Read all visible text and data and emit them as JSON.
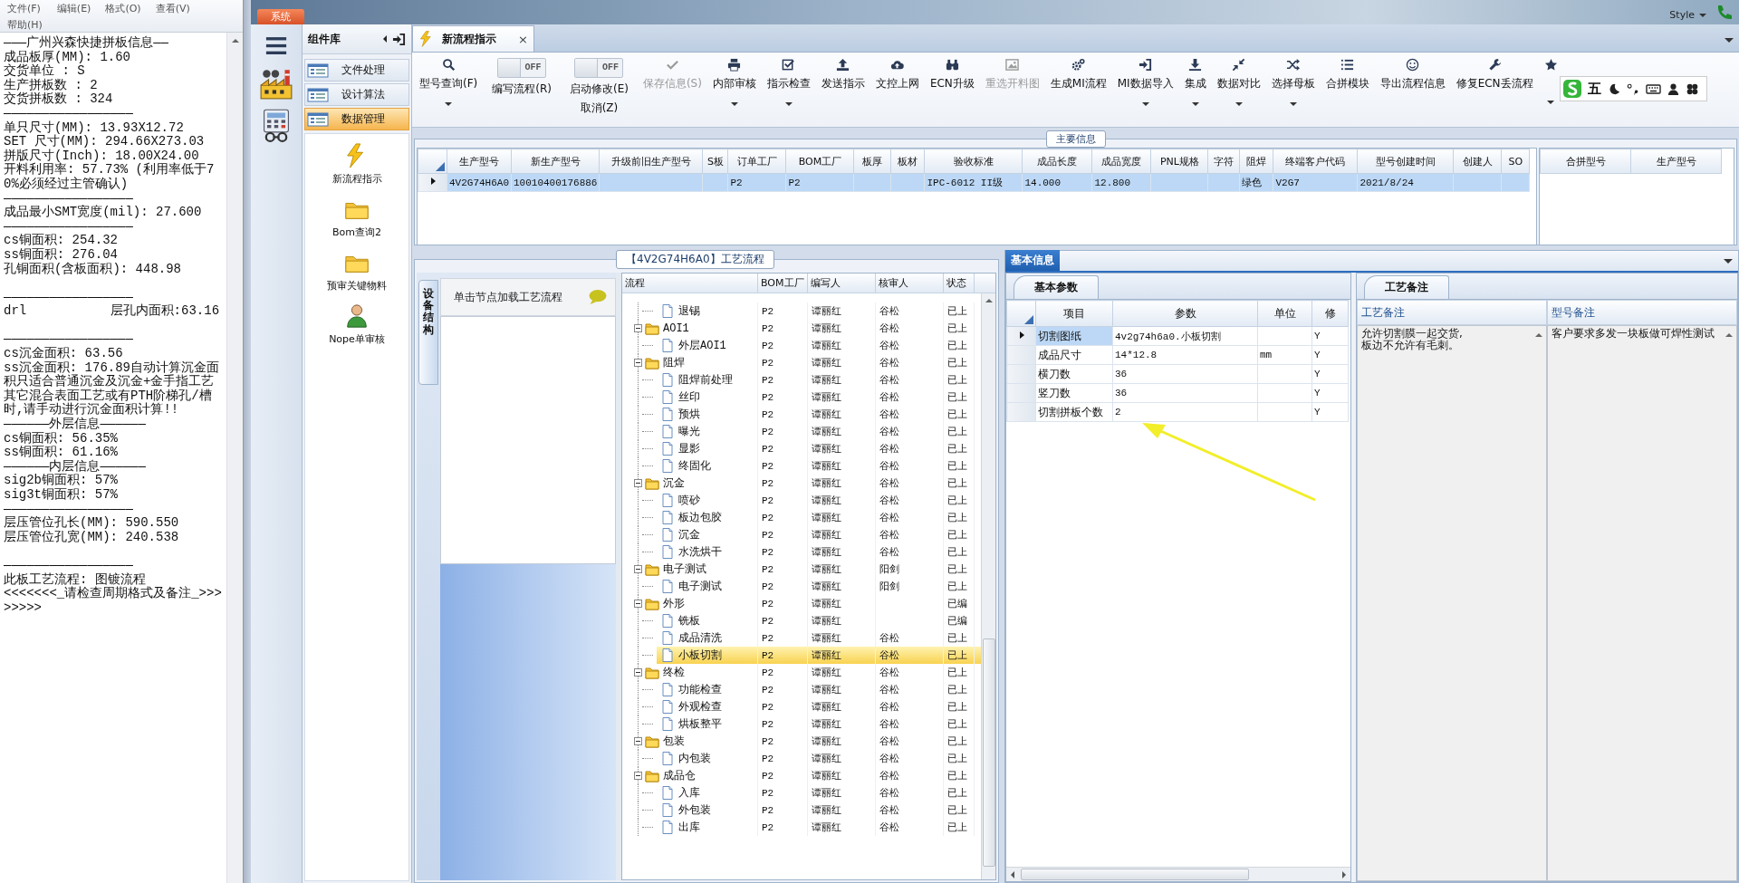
{
  "notepad": {
    "menu": [
      "文件(F)",
      "编辑(E)",
      "格式(O)",
      "查看(V)",
      "帮助(H)"
    ],
    "lines": [
      {
        "text": "———广州兴森快捷拼板信息——"
      },
      {
        "text": "成品板厚(MM): 1.60"
      },
      {
        "text": "交货单位 : S"
      },
      {
        "text": "生产拼板数 : 2"
      },
      {
        "text": "交货拼板数 : 324"
      },
      {
        "text": "—————————————————"
      },
      {
        "text": "单只尺寸(MM): 13.93X12.72"
      },
      {
        "text": "SET 尺寸(MM): 294.66X273.03"
      },
      {
        "text": "拼版尺寸(Inch): 18.00X24.00"
      },
      {
        "text": "开料利用率: 57.73% (利用率低于70%必须经过主管确认)"
      },
      {
        "text": "—————————————————"
      },
      {
        "text": "成品最小SMT宽度(mil): 27.600"
      },
      {
        "text": "—————————————————"
      },
      {
        "text": "cs铜面积: 254.32"
      },
      {
        "text": "ss铜面积: 276.04"
      },
      {
        "text": "孔铜面积(含板面积): 448.98"
      },
      {
        "text": "—————————————————",
        "gap_before": true
      },
      {
        "text": "drl           层孔内面积:63.16"
      },
      {
        "text": "—————————————————",
        "gap_before": true
      },
      {
        "text": "cs沉金面积: 63.56"
      },
      {
        "text": "ss沉金面积: 176.89自动计算沉金面积只适合普通沉金及沉金+金手指工艺"
      },
      {
        "text": "其它混合表面工艺或有PTH阶梯孔/槽时,请手动进行沉金面积计算!!"
      },
      {
        "text": "——————外层信息——————"
      },
      {
        "text": "cs铜面积: 56.35%"
      },
      {
        "text": "ss铜面积: 61.16%"
      },
      {
        "text": "——————内层信息——————"
      },
      {
        "text": "sig2b铜面积: 57%"
      },
      {
        "text": "sig3t铜面积: 57%"
      },
      {
        "text": "—————————————————"
      },
      {
        "text": "层压管位孔长(MM): 590.550"
      },
      {
        "text": "层压管位孔宽(MM): 240.538"
      },
      {
        "text": "—————————————————",
        "gap_before": true
      },
      {
        "text": "此板工艺流程: 图镀流程"
      },
      {
        "text": "<<<<<<<_请检查周期格式及备注_>>>>>>>>"
      }
    ]
  },
  "app": {
    "system_tab": "系统",
    "style_label": "Style"
  },
  "sidebar": {
    "title": "组件库",
    "items": [
      {
        "label": "文件处理",
        "selected": false
      },
      {
        "label": "设计算法",
        "selected": false
      },
      {
        "label": "数据管理",
        "selected": true
      }
    ],
    "launchers": [
      {
        "label": "新流程指示"
      },
      {
        "label": "Bom查询2"
      },
      {
        "label": "预审关键物料"
      },
      {
        "label": "Nope单审核"
      }
    ]
  },
  "document_tab": {
    "label": "新流程指示",
    "close": "×"
  },
  "toolbar": {
    "items": [
      {
        "kind": "button",
        "label": "型号查询(F)",
        "dropdown": true,
        "disabled": false
      },
      {
        "kind": "toggle",
        "switch": "OFF",
        "on": false,
        "label": "编写流程(R)"
      },
      {
        "kind": "toggle",
        "switch": "OFF",
        "on": false,
        "label": "启动修改(E)",
        "label2": "取消(Z)"
      },
      {
        "kind": "button",
        "label": "保存信息(S)",
        "dropdown": false,
        "disabled": true
      },
      {
        "kind": "button",
        "label": "内部审核",
        "dropdown": true,
        "disabled": false
      },
      {
        "kind": "button",
        "label": "指示检查",
        "dropdown": true,
        "disabled": false
      },
      {
        "kind": "button",
        "label": "发送指示",
        "dropdown": false,
        "disabled": false
      },
      {
        "kind": "button",
        "label": "文控上网",
        "dropdown": false,
        "disabled": false
      },
      {
        "kind": "button",
        "label": "ECN升级",
        "dropdown": false,
        "disabled": false
      },
      {
        "kind": "button",
        "label": "重选开料图",
        "dropdown": false,
        "disabled": true
      },
      {
        "kind": "button",
        "label": "生成MI流程",
        "dropdown": false,
        "disabled": false
      },
      {
        "kind": "button",
        "label": "MI数据导入",
        "dropdown": true,
        "disabled": false
      },
      {
        "kind": "button",
        "label": "集成",
        "dropdown": true,
        "disabled": false
      },
      {
        "kind": "button",
        "label": "数据对比",
        "dropdown": true,
        "disabled": false
      },
      {
        "kind": "button",
        "label": "选择母板",
        "dropdown": true,
        "disabled": false
      },
      {
        "kind": "button",
        "label": "合拼模块",
        "dropdown": false,
        "disabled": false
      },
      {
        "kind": "button",
        "label": "导出流程信息",
        "dropdown": false,
        "disabled": false
      },
      {
        "kind": "button",
        "label": "修复ECN丢流程",
        "dropdown": false,
        "disabled": false
      },
      {
        "kind": "button",
        "dropdown": true,
        "disabled": false
      }
    ]
  },
  "ime": {
    "mode": "五"
  },
  "main_info": {
    "title": "主要信息",
    "columns": [
      "生产型号",
      "新生产型号",
      "升级前旧生产型号",
      "S板",
      "订单工厂",
      "BOM工厂",
      "板厚",
      "板材",
      "验收标准",
      "成品长度",
      "成品宽度",
      "PNL规格",
      "字符",
      "阻焊",
      "终端客户代码",
      "型号创建时间",
      "创建人",
      "SO"
    ],
    "rows": [
      {
        "selected": true,
        "cells": [
          "4V2G74H6A0",
          "10010400176886",
          null,
          null,
          "P2",
          "P2",
          null,
          null,
          "IPC-6012 II级",
          "14.000",
          "12.800",
          null,
          null,
          "绿色",
          "V2G7",
          "2021/8/24",
          null,
          null
        ]
      }
    ],
    "side_columns": [
      "合拼型号",
      "生产型号"
    ]
  },
  "process": {
    "title": "【4V2G74H6A0】工艺流程",
    "side_tab": "设备结构",
    "hint": "单击节点加载工艺流程",
    "columns": [
      "流程",
      "BOM工厂",
      "编写人",
      "核审人",
      "状态"
    ],
    "rows": [
      {
        "kind": "file",
        "name": "退锡",
        "bom": "P2",
        "writer": "谭丽红",
        "reviewer": "谷松",
        "status": "已上",
        "selected": false
      },
      {
        "kind": "folder",
        "name": "AOI1",
        "bom": "P2",
        "writer": "谭丽红",
        "reviewer": "谷松",
        "status": "已上",
        "selected": false,
        "expanded": true,
        "children": [
          {
            "kind": "file",
            "name": "外层AOI1",
            "bom": "P2",
            "writer": "谭丽红",
            "reviewer": "谷松",
            "status": "已上",
            "selected": false
          }
        ]
      },
      {
        "kind": "folder",
        "name": "阻焊",
        "bom": "P2",
        "writer": "谭丽红",
        "reviewer": "谷松",
        "status": "已上",
        "selected": false,
        "expanded": true,
        "children": [
          {
            "kind": "file",
            "name": "阻焊前处理",
            "bom": "P2",
            "writer": "谭丽红",
            "reviewer": "谷松",
            "status": "已上",
            "selected": false
          },
          {
            "kind": "file",
            "name": "丝印",
            "bom": "P2",
            "writer": "谭丽红",
            "reviewer": "谷松",
            "status": "已上",
            "selected": false
          },
          {
            "kind": "file",
            "name": "预烘",
            "bom": "P2",
            "writer": "谭丽红",
            "reviewer": "谷松",
            "status": "已上",
            "selected": false
          },
          {
            "kind": "file",
            "name": "曝光",
            "bom": "P2",
            "writer": "谭丽红",
            "reviewer": "谷松",
            "status": "已上",
            "selected": false
          },
          {
            "kind": "file",
            "name": "显影",
            "bom": "P2",
            "writer": "谭丽红",
            "reviewer": "谷松",
            "status": "已上",
            "selected": false
          },
          {
            "kind": "file",
            "name": "终固化",
            "bom": "P2",
            "writer": "谭丽红",
            "reviewer": "谷松",
            "status": "已上",
            "selected": false
          }
        ]
      },
      {
        "kind": "folder",
        "name": "沉金",
        "bom": "P2",
        "writer": "谭丽红",
        "reviewer": "谷松",
        "status": "已上",
        "selected": false,
        "expanded": true,
        "children": [
          {
            "kind": "file",
            "name": "喷砂",
            "bom": "P2",
            "writer": "谭丽红",
            "reviewer": "谷松",
            "status": "已上",
            "selected": false
          },
          {
            "kind": "file",
            "name": "板边包胶",
            "bom": "P2",
            "writer": "谭丽红",
            "reviewer": "谷松",
            "status": "已上",
            "selected": false
          },
          {
            "kind": "file",
            "name": "沉金",
            "bom": "P2",
            "writer": "谭丽红",
            "reviewer": "谷松",
            "status": "已上",
            "selected": false
          },
          {
            "kind": "file",
            "name": "水洗烘干",
            "bom": "P2",
            "writer": "谭丽红",
            "reviewer": "谷松",
            "status": "已上",
            "selected": false
          }
        ]
      },
      {
        "kind": "folder",
        "name": "电子测试",
        "bom": "P2",
        "writer": "谭丽红",
        "reviewer": "阳剑",
        "status": "已上",
        "selected": false,
        "expanded": true,
        "children": [
          {
            "kind": "file",
            "name": "电子测试",
            "bom": "P2",
            "writer": "谭丽红",
            "reviewer": "阳剑",
            "status": "已上",
            "selected": false
          }
        ]
      },
      {
        "kind": "folder",
        "name": "外形",
        "bom": "P2",
        "writer": "谭丽红",
        "status": "已编",
        "selected": false,
        "expanded": true,
        "children": [
          {
            "kind": "file",
            "name": "铣板",
            "bom": "P2",
            "writer": "谭丽红",
            "status": "已编",
            "selected": false
          },
          {
            "kind": "file",
            "name": "成品清洗",
            "bom": "P2",
            "writer": "谭丽红",
            "reviewer": "谷松",
            "status": "已上",
            "selected": false
          },
          {
            "kind": "file",
            "name": "小板切割",
            "bom": "P2",
            "writer": "谭丽红",
            "reviewer": "谷松",
            "status": "已上",
            "selected": true
          }
        ]
      },
      {
        "kind": "folder",
        "name": "终检",
        "bom": "P2",
        "writer": "谭丽红",
        "reviewer": "谷松",
        "status": "已上",
        "selected": false,
        "expanded": true,
        "children": [
          {
            "kind": "file",
            "name": "功能检查",
            "bom": "P2",
            "writer": "谭丽红",
            "reviewer": "谷松",
            "status": "已上",
            "selected": false
          },
          {
            "kind": "file",
            "name": "外观检查",
            "bom": "P2",
            "writer": "谭丽红",
            "reviewer": "谷松",
            "status": "已上",
            "selected": false
          },
          {
            "kind": "file",
            "name": "烘板整平",
            "bom": "P2",
            "writer": "谭丽红",
            "reviewer": "谷松",
            "status": "已上",
            "selected": false
          }
        ]
      },
      {
        "kind": "folder",
        "name": "包装",
        "bom": "P2",
        "writer": "谭丽红",
        "reviewer": "谷松",
        "status": "已上",
        "selected": false,
        "expanded": true,
        "children": [
          {
            "kind": "file",
            "name": "内包装",
            "bom": "P2",
            "writer": "谭丽红",
            "reviewer": "谷松",
            "status": "已上",
            "selected": false
          }
        ]
      },
      {
        "kind": "folder",
        "name": "成品仓",
        "bom": "P2",
        "writer": "谭丽红",
        "reviewer": "谷松",
        "status": "已上",
        "selected": false,
        "expanded": true,
        "children": [
          {
            "kind": "file",
            "name": "入库",
            "bom": "P2",
            "writer": "谭丽红",
            "reviewer": "谷松",
            "status": "已上",
            "selected": false
          },
          {
            "kind": "file",
            "name": "外包装",
            "bom": "P2",
            "writer": "谭丽红",
            "reviewer": "谷松",
            "status": "已上",
            "selected": false
          },
          {
            "kind": "file",
            "name": "出库",
            "bom": "P2",
            "writer": "谭丽红",
            "reviewer": "谷松",
            "status": "已上",
            "selected": false
          }
        ]
      }
    ]
  },
  "info": {
    "tab": "基本信息",
    "params": {
      "tab": "基本参数",
      "columns": [
        "项目",
        "参数",
        "单位",
        "修"
      ],
      "rows": [
        {
          "selected": true,
          "cells": [
            "切割图纸",
            "4v2g74h6a0.小板切割",
            null,
            "Y"
          ]
        },
        {
          "selected": false,
          "cells": [
            "成品尺寸",
            "14*12.8",
            "mm",
            "Y"
          ]
        },
        {
          "selected": false,
          "cells": [
            "横刀数",
            "36",
            null,
            "Y"
          ]
        },
        {
          "selected": false,
          "cells": [
            "竖刀数",
            "36",
            null,
            "Y"
          ]
        },
        {
          "selected": false,
          "cells": [
            "切割拼板个数",
            "2",
            null,
            "Y"
          ]
        }
      ]
    },
    "remarks": {
      "tab": "工艺备注",
      "columns": [
        "工艺备注",
        "型号备注"
      ],
      "values": [
        "允许切割膜一起交货,\n板边不允许有毛刺。",
        "客户要求多发一块板做可焊性测试"
      ]
    }
  }
}
